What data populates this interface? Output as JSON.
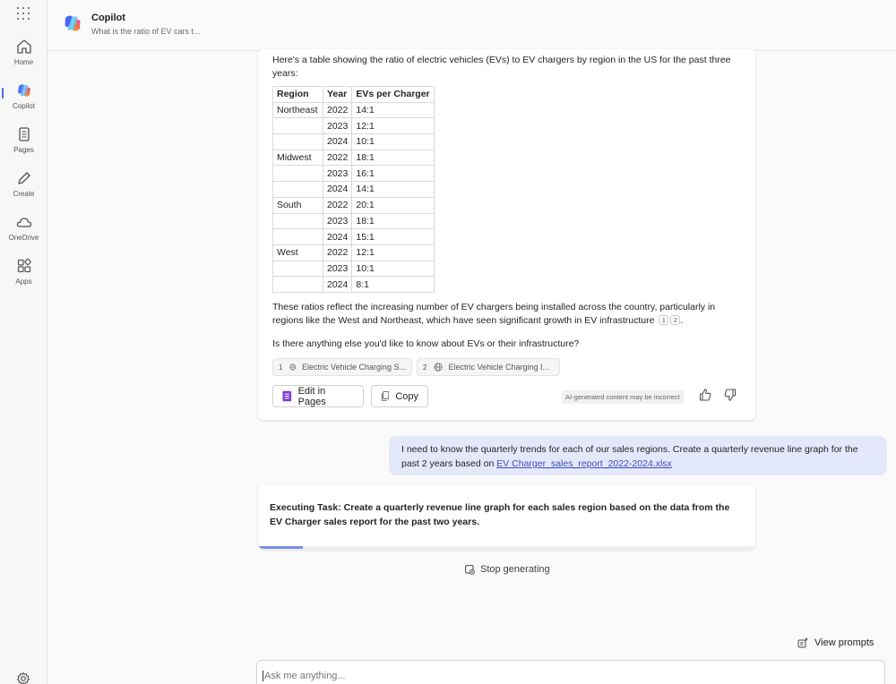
{
  "app": {
    "title": "Copilot",
    "subtitle": "What is the ratio of EV cars t..."
  },
  "rail": {
    "items": [
      {
        "label": "Home",
        "icon": "home-icon"
      },
      {
        "label": "Copilot",
        "icon": "copilot-icon",
        "active": true
      },
      {
        "label": "Pages",
        "icon": "pages-icon"
      },
      {
        "label": "Create",
        "icon": "pen-icon"
      },
      {
        "label": "OneDrive",
        "icon": "cloud-icon"
      },
      {
        "label": "Apps",
        "icon": "apps-icon"
      }
    ]
  },
  "response": {
    "intro": "Here's a table showing the ratio of electric vehicles (EVs) to EV chargers by region in the US for the past three years:",
    "table": {
      "headers": [
        "Region",
        "Year",
        "EVs per Charger"
      ],
      "rows": [
        [
          "Northeast",
          "2022",
          "14:1"
        ],
        [
          "",
          "2023",
          "12:1"
        ],
        [
          "",
          "2024",
          "10:1"
        ],
        [
          "Midwest",
          "2022",
          "18:1"
        ],
        [
          "",
          "2023",
          "16:1"
        ],
        [
          "",
          "2024",
          "14:1"
        ],
        [
          "South",
          "2022",
          "20:1"
        ],
        [
          "",
          "2023",
          "18:1"
        ],
        [
          "",
          "2024",
          "15:1"
        ],
        [
          "West",
          "2022",
          "12:1"
        ],
        [
          "",
          "2023",
          "10:1"
        ],
        [
          "",
          "2024",
          "8:1"
        ]
      ]
    },
    "reflection": "These ratios reflect the increasing number of EV chargers being installed across the country, particularly in regions like the West and Northeast, which have seen significant growth in EV infrastructure",
    "citations": [
      "1",
      "2"
    ],
    "question": "Is there anything else you'd like to know about EVs or their infrastructure?",
    "references": [
      {
        "num": "1",
        "label": "Electric Vehicle Charging S..."
      },
      {
        "num": "2",
        "label": "Electric Vehicle Charging I..."
      }
    ],
    "actions": {
      "edit_in_pages": "Edit in Pages",
      "copy": "Copy"
    },
    "disclaimer": "AI-generated content may be incorrect"
  },
  "user_message": {
    "text": "I need to know the quarterly trends for each of our sales regions. Create a quarterly revenue line graph for the past 2 years based on",
    "attachment": "EV Charger_sales_report_2022-2024.xlsx"
  },
  "task": {
    "text": "Executing Task: Create a quarterly revenue line graph for each sales region based on the data from the EV Charger sales report for the past two years.",
    "progress": 0.09
  },
  "stop_label": "Stop generating",
  "view_prompts_label": "View prompts",
  "input": {
    "placeholder": "Ask me anything...",
    "value": ""
  },
  "colors": {
    "accent": "#4f6bed",
    "user_bubble": "#e4e8fb",
    "progress": "#7b8fe8"
  }
}
